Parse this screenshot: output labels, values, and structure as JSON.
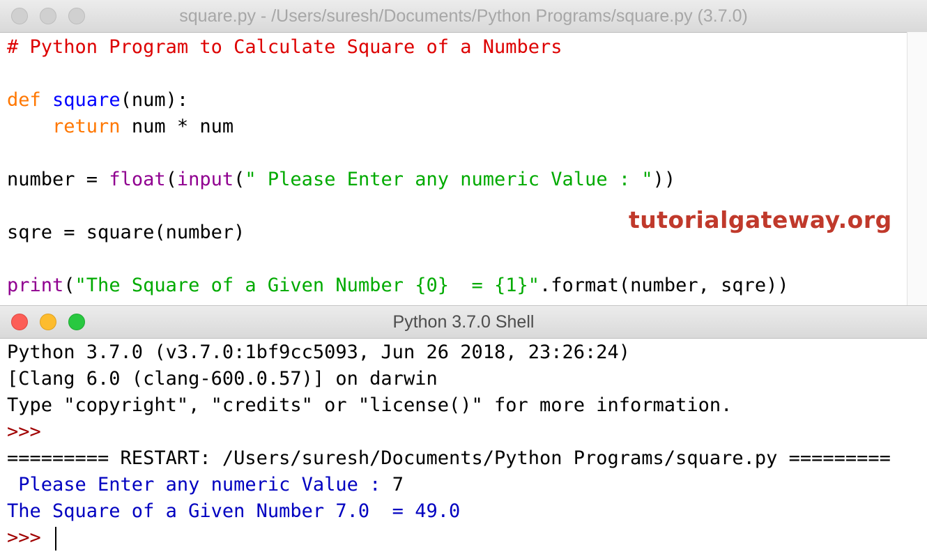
{
  "editor": {
    "title": "square.py - /Users/suresh/Documents/Python Programs/square.py (3.7.0)",
    "lines": [
      [
        {
          "t": "# Python Program to Calculate Square of a Numbers",
          "c": "comment"
        }
      ],
      [],
      [
        {
          "t": "def",
          "c": "kw"
        },
        {
          "t": " ",
          "c": "plain"
        },
        {
          "t": "square",
          "c": "def"
        },
        {
          "t": "(num):",
          "c": "plain"
        }
      ],
      [
        {
          "t": "    ",
          "c": "plain"
        },
        {
          "t": "return",
          "c": "kw"
        },
        {
          "t": " num * num",
          "c": "plain"
        }
      ],
      [],
      [
        {
          "t": "number = ",
          "c": "plain"
        },
        {
          "t": "float",
          "c": "bi"
        },
        {
          "t": "(",
          "c": "plain"
        },
        {
          "t": "input",
          "c": "bi"
        },
        {
          "t": "(",
          "c": "plain"
        },
        {
          "t": "\" Please Enter any numeric Value : \"",
          "c": "str"
        },
        {
          "t": "))",
          "c": "plain"
        }
      ],
      [],
      [
        {
          "t": "sqre = square(number)",
          "c": "plain"
        }
      ],
      [],
      [
        {
          "t": "print",
          "c": "bi"
        },
        {
          "t": "(",
          "c": "plain"
        },
        {
          "t": "\"The Square of a Given Number {0}  = {1}\"",
          "c": "str"
        },
        {
          "t": ".format(number, sqre))",
          "c": "plain"
        }
      ]
    ]
  },
  "watermark": "tutorialgateway.org",
  "shell": {
    "title": "Python 3.7.0 Shell",
    "lines": [
      [
        {
          "t": "Python 3.7.0 (v3.7.0:1bf9cc5093, Jun 26 2018, 23:26:24)",
          "c": "plain"
        }
      ],
      [
        {
          "t": "[Clang 6.0 (clang-600.0.57)] on darwin",
          "c": "plain"
        }
      ],
      [
        {
          "t": "Type \"copyright\", \"credits\" or \"license()\" for more information.",
          "c": "plain"
        }
      ],
      [
        {
          "t": ">>> ",
          "c": "prompt"
        }
      ],
      [
        {
          "t": "========= RESTART: /Users/suresh/Documents/Python Programs/square.py =========",
          "c": "plain"
        }
      ],
      [
        {
          "t": " Please Enter any numeric Value : ",
          "c": "out"
        },
        {
          "t": "7",
          "c": "plain"
        }
      ],
      [
        {
          "t": "The Square of a Given Number 7.0  = 49.0",
          "c": "out"
        }
      ],
      [
        {
          "t": ">>> ",
          "c": "prompt"
        }
      ]
    ]
  }
}
